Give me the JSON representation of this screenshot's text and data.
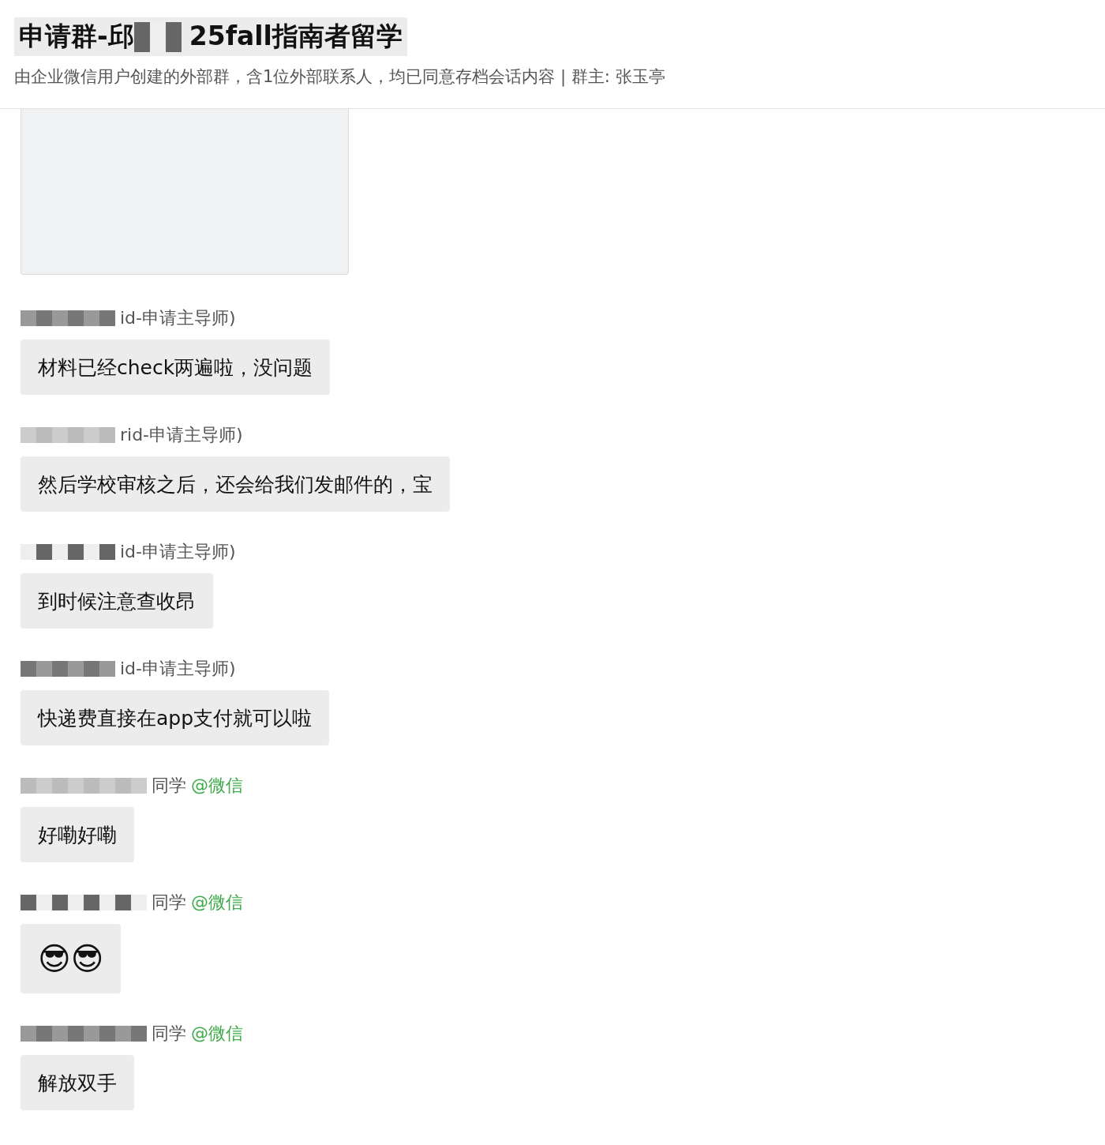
{
  "header": {
    "title_start": "申请群-邱",
    "title_end": "25fall指南者留学",
    "subtitle": "由企业微信用户创建的外部群，含1位外部联系人，均已同意存档会话内容 | 群主: 张玉亭"
  },
  "messages": [
    {
      "kind": "image"
    },
    {
      "kind": "text",
      "sender": "id-申请主导师)",
      "text": "材料已经check两遍啦，没问题"
    },
    {
      "kind": "text",
      "sender": "rid-申请主导师)",
      "text": "然后学校审核之后，还会给我们发邮件的，宝"
    },
    {
      "kind": "text",
      "sender": "id-申请主导师)",
      "text": "到时候注意查收昂"
    },
    {
      "kind": "text",
      "sender": "id-申请主导师)",
      "text": "快递费直接在app支付就可以啦"
    },
    {
      "kind": "text",
      "sender": "同学",
      "source": "@微信",
      "text": "好嘞好嘞"
    },
    {
      "kind": "emoji",
      "sender": "同学",
      "source": "@微信",
      "text": "😎😎"
    },
    {
      "kind": "text",
      "sender": "同学",
      "source": "@微信",
      "text": "解放双手"
    }
  ]
}
